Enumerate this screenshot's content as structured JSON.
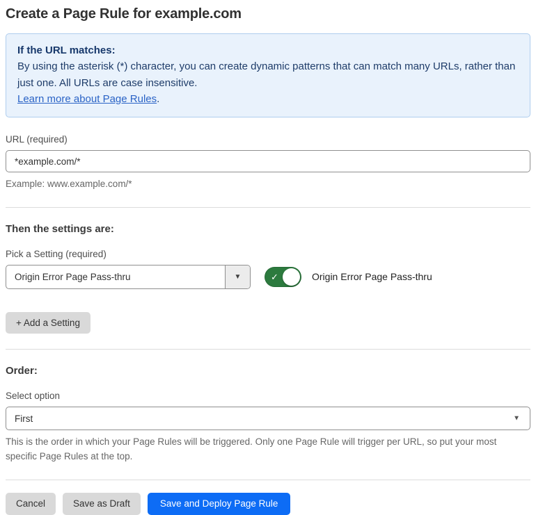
{
  "page": {
    "title": "Create a Page Rule for example.com"
  },
  "info_box": {
    "heading": "If the URL matches:",
    "body": "By using the asterisk (*) character, you can create dynamic patterns that can match many URLs, rather than just one. All URLs are case insensitive.",
    "link_label": "Learn more about Page Rules",
    "link_suffix": "."
  },
  "url_field": {
    "label": "URL (required)",
    "value": "*example.com/*",
    "helper": "Example: www.example.com/*"
  },
  "settings_section": {
    "heading": "Then the settings are:",
    "picker_label": "Pick a Setting (required)",
    "picker_value": "Origin Error Page Pass-thru",
    "toggle_label": "Origin Error Page Pass-thru",
    "toggle_state": "on",
    "add_setting_label": "+ Add a Setting"
  },
  "order_section": {
    "heading": "Order:",
    "select_label": "Select option",
    "select_value": "First",
    "helper": "This is the order in which your Page Rules will be triggered. Only one Page Rule will trigger per URL, so put your most specific Page Rules at the top."
  },
  "footer": {
    "cancel_label": "Cancel",
    "save_draft_label": "Save as Draft",
    "save_deploy_label": "Save and Deploy Page Rule"
  },
  "icons": {
    "check": "✓",
    "dropdown_arrow": "▼"
  },
  "colors": {
    "accent_blue": "#0d6cf5",
    "info_bg": "#e9f2fc",
    "info_border": "#aecdee",
    "info_text": "#1e3c69",
    "link_blue": "#2a63c6",
    "toggle_green": "#2c7a3e",
    "button_gray": "#d9d9d9"
  }
}
